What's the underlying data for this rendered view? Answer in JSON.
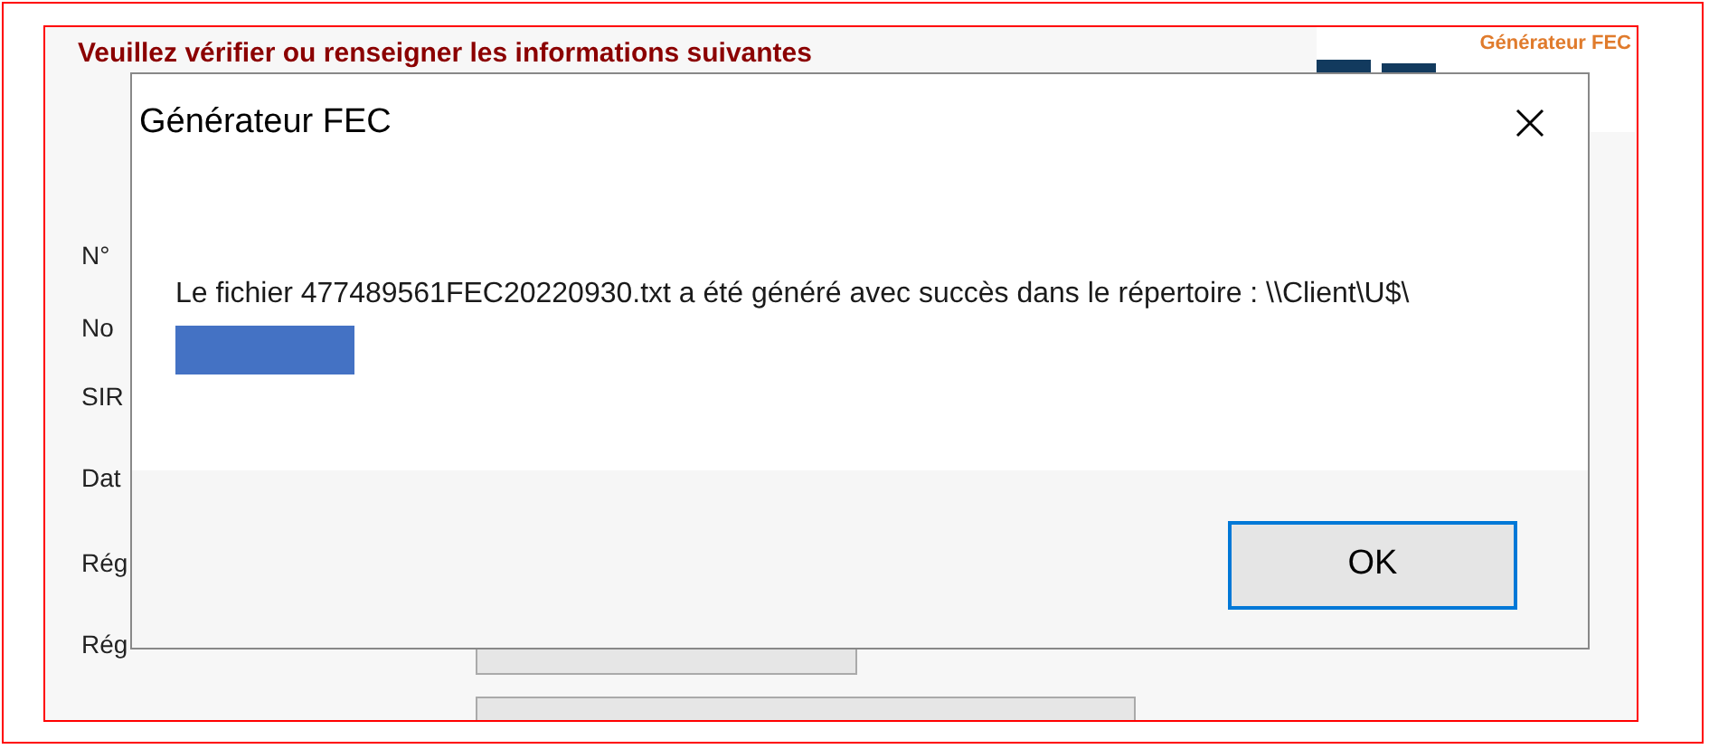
{
  "form": {
    "heading": "Veuillez vérifier ou renseigner les informations suivantes",
    "logo_caption": "Générateur FEC",
    "labels": [
      "N°",
      "No",
      "SIR",
      "Dat",
      "Rég",
      "Rég"
    ]
  },
  "dialog": {
    "title": "Générateur FEC",
    "message": "Le fichier 477489561FEC20220930.txt a été généré avec succès dans le répertoire : \\\\Client\\U$\\",
    "redacted": true,
    "buttons": [
      {
        "label": "OK",
        "selected": true
      }
    ]
  }
}
